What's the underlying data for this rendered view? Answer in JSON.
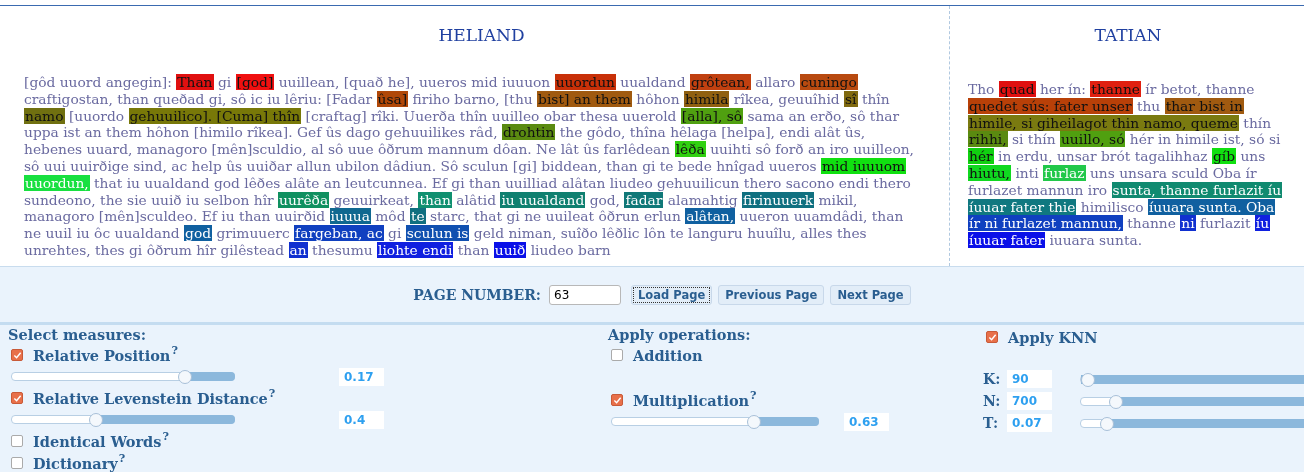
{
  "texts": [
    {
      "title": "HELIAND",
      "lines": [
        [
          {
            "text": "[gôd uuord angegin]:"
          },
          {
            "text": "Than",
            "color": "#e01010"
          },
          {
            "text": "gi"
          },
          {
            "text": "[god]",
            "color": "#f01010"
          },
          {
            "text": "uuillean, [quað he], uueros mid iuuuon"
          },
          {
            "text": "uuordun",
            "color": "#c83008"
          },
          {
            "text": "uualdand"
          },
          {
            "text": "grôtean,",
            "color": "#c04010"
          },
          {
            "text": "allaro"
          },
          {
            "text": "cuningo",
            "color": "#b84a10"
          }
        ],
        [
          {
            "text": "craftigostan, than queðad gi, sô ic iu lêriu: [Fadar"
          },
          {
            "text": "ûsa]",
            "color": "#b04808"
          },
          {
            "text": "firiho barno, [thu"
          },
          {
            "text": "bist] an them",
            "color": "#a05a10"
          },
          {
            "text": "hôhon"
          },
          {
            "text": "himila",
            "color": "#906010"
          },
          {
            "text": "rîkea, geuuîhid"
          },
          {
            "text": "sî",
            "color": "#806a10"
          },
          {
            "text": "thîn"
          }
        ],
        [
          {
            "text": "namo",
            "color": "#707010"
          },
          {
            "text": "[uuordo"
          },
          {
            "text": "gehuuilico]. [Cuma] thîn",
            "color": "#787808"
          },
          {
            "text": "[craftag] rîki. Uuerða thîn uuilleo obar thesa uuerold"
          },
          {
            "text": "[alla], sô",
            "color": "#50a010"
          },
          {
            "text": "sama an erðo, sô thar"
          }
        ],
        [
          {
            "text": "uppa ist an them hôhon [himilo rîkea]. Gef ûs dago gehuuilikes râd,"
          },
          {
            "text": "drohtin",
            "color": "#5a8a10"
          },
          {
            "text": "the gôdo, thîna hêlaga [helpa], endi alât ûs,"
          }
        ],
        [
          {
            "text": "hebenes uuard, managoro [mên]sculdio, al sô uue ôðrum mannum dôan. Ne lât ûs farlêdean"
          },
          {
            "text": "lêða",
            "color": "#30d010"
          },
          {
            "text": "uuihti sô forð an iro uuilleon,"
          }
        ],
        [
          {
            "text": "sô uui uuirðige sind, ac help ûs uuiðar allun ubilon dâdiun. Sô sculun [gi] biddean, than gi te bede hnîgad uueros"
          },
          {
            "text": "mid iuuuom",
            "color": "#10e010"
          }
        ],
        [
          {
            "text": "uuordun,",
            "color": "#18e040"
          },
          {
            "text": "that iu uualdand god lêðes alâte an leutcunnea. Ef gi than uuilliad alâtan liudeo gehuuilicun thero sacono endi thero"
          }
        ],
        [
          {
            "text": "sundeono, the sie uuið iu selbon hîr"
          },
          {
            "text": "uurêða",
            "color": "#109060"
          },
          {
            "text": "geuuirkeat,"
          },
          {
            "text": "than",
            "color": "#109070"
          },
          {
            "text": "alâtid"
          },
          {
            "text": "iu uualdand",
            "color": "#108070"
          },
          {
            "text": "god,"
          },
          {
            "text": "fadar",
            "color": "#107878"
          },
          {
            "text": "alamahtig"
          },
          {
            "text": "firinuuerk",
            "color": "#107080"
          },
          {
            "text": "mikil,"
          }
        ],
        [
          {
            "text": "managoro [mên]sculdeo. Ef iu than uuirðid"
          },
          {
            "text": "iuuua",
            "color": "#106890"
          },
          {
            "text": "môd"
          },
          {
            "text": "te",
            "color": "#107080"
          },
          {
            "text": "starc, that gi ne uuileat ôðrun erlun"
          },
          {
            "text": "alâtan,",
            "color": "#1060a0"
          },
          {
            "text": "uueron uuamdâdi, than"
          }
        ],
        [
          {
            "text": "ne uuil iu ôc uualdand"
          },
          {
            "text": "god",
            "color": "#1060a0"
          },
          {
            "text": "grimuuerc"
          },
          {
            "text": "fargeban, ac",
            "color": "#1040c0"
          },
          {
            "text": "gi"
          },
          {
            "text": "sculun is",
            "color": "#1050b0"
          },
          {
            "text": "geld niman, suîðo lêðlic lôn te languru huuîlu, alles thes"
          }
        ],
        [
          {
            "text": "unrehtes, thes gi ôðrum hîr gilêstead"
          },
          {
            "text": "an",
            "color": "#1030d0"
          },
          {
            "text": "thesumu"
          },
          {
            "text": "liohte endi",
            "color": "#1020e0"
          },
          {
            "text": "than"
          },
          {
            "text": "uuið",
            "color": "#0a10e8"
          },
          {
            "text": "liudeo barn"
          }
        ]
      ]
    },
    {
      "title": "TATIAN",
      "lines": [
        [
          {
            "text": "Tho"
          },
          {
            "text": "quad",
            "color": "#e01010"
          },
          {
            "text": "her ín:"
          },
          {
            "text": "thanne",
            "color": "#e02010"
          },
          {
            "text": "ír betot, thanne"
          }
        ],
        [
          {
            "text": "quedet sús: fater unser",
            "color": "#b84008"
          },
          {
            "text": "thu"
          },
          {
            "text": "thar bist in",
            "color": "#a05a10"
          }
        ],
        [
          {
            "text": "himile, si giheilagot thin namo, queme",
            "color": "#7a7a10"
          },
          {
            "text": "thín"
          }
        ],
        [
          {
            "text": "rihhi,",
            "color": "#5a8a10"
          },
          {
            "text": "si thín"
          },
          {
            "text": "uuillo, só",
            "color": "#50a010"
          },
          {
            "text": "hér in himile ist, só si"
          }
        ],
        [
          {
            "text": "hér",
            "color": "#10d010"
          },
          {
            "text": "in erdu, unsar brót tagalihhaz"
          },
          {
            "text": "gíb",
            "color": "#10e010"
          },
          {
            "text": "uns"
          }
        ],
        [
          {
            "text": "hiutu,",
            "color": "#10d820"
          },
          {
            "text": "inti"
          },
          {
            "text": "furlaz",
            "color": "#22c84a"
          },
          {
            "text": "uns unsara sculd Oba ír"
          }
        ],
        [
          {
            "text": "furlazet mannun iro"
          },
          {
            "text": "sunta, thanne furlazit íu",
            "color": "#108a70"
          }
        ],
        [
          {
            "text": "íuuar fater thie",
            "color": "#107880"
          },
          {
            "text": "himilisco"
          },
          {
            "text": "íuuara sunta. Oba",
            "color": "#1060a0"
          }
        ],
        [
          {
            "text": "ír ni furlazet mannun,",
            "color": "#1040c0"
          },
          {
            "text": "thanne"
          },
          {
            "text": "ni",
            "color": "#1030d0"
          },
          {
            "text": "furlazit"
          },
          {
            "text": "íu",
            "color": "#1020e0"
          }
        ],
        [
          {
            "text": "íuuar fater",
            "color": "#0a10e8"
          },
          {
            "text": "iuuara sunta."
          }
        ]
      ]
    }
  ],
  "page_nav": {
    "label": "PAGE NUMBER:",
    "value": "63",
    "buttons": [
      {
        "label": "Load Page",
        "focused": true
      },
      {
        "label": "Previous Page",
        "focused": false
      },
      {
        "label": "Next Page",
        "focused": false
      }
    ]
  },
  "measures": {
    "heading": "Select measures:",
    "items": [
      {
        "label": "Relative Position",
        "help": "?",
        "checked": true,
        "slider": {
          "reading": "0.17"
        }
      },
      {
        "label": "Relative Levenstein Distance",
        "help": "?",
        "checked": true,
        "slider": {
          "reading": "0.4"
        }
      },
      {
        "label": "Identical Words",
        "help": "?",
        "checked": false
      },
      {
        "label": "Dictionary",
        "help": "?",
        "checked": false
      }
    ]
  },
  "operations": {
    "heading": "Apply operations:",
    "items": [
      {
        "label": "Addition",
        "checked": false
      },
      {
        "label": "Multiplication",
        "help": "?",
        "checked": true,
        "slider": {
          "reading": "0.63"
        }
      }
    ]
  },
  "knn": {
    "label": "Apply KNN",
    "checked": true,
    "params": [
      {
        "label": "K:",
        "value": "90"
      },
      {
        "label": "N:",
        "value": "700"
      },
      {
        "label": "T:",
        "value": "0.07"
      }
    ]
  }
}
